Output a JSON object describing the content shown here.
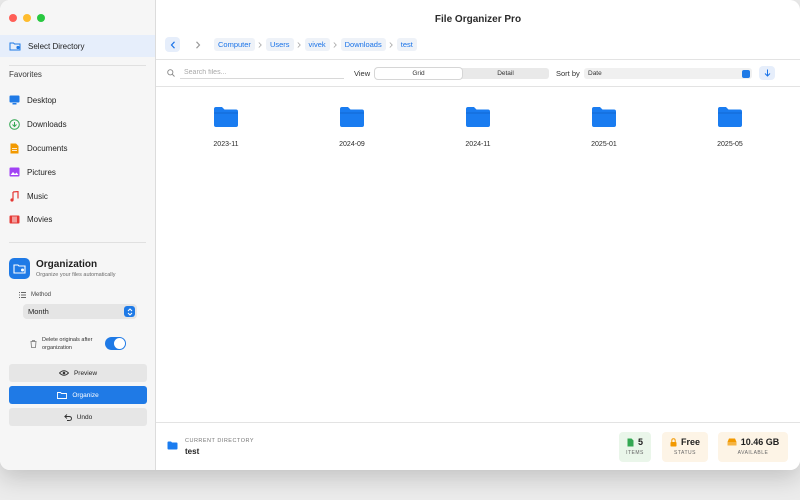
{
  "app": {
    "title": "File Organizer Pro"
  },
  "colors": {
    "accent": "#1f7ae6",
    "folder": "#1a7cf0",
    "green": "#34a853",
    "orange": "#f29900"
  },
  "sidebar": {
    "select_directory": "Select Directory",
    "favorites_title": "Favorites",
    "favorites": [
      {
        "label": "Desktop",
        "icon": "desktop-icon"
      },
      {
        "label": "Downloads",
        "icon": "download-icon"
      },
      {
        "label": "Documents",
        "icon": "document-icon"
      },
      {
        "label": "Pictures",
        "icon": "picture-icon"
      },
      {
        "label": "Music",
        "icon": "music-icon"
      },
      {
        "label": "Movies",
        "icon": "movie-icon"
      }
    ],
    "organization": {
      "title": "Organization",
      "subtitle": "Organize your files automatically",
      "method_label": "Method",
      "method_value": "Month",
      "delete_label": "Delete originals after organization",
      "delete_enabled": true,
      "preview_label": "Preview",
      "organize_label": "Organize",
      "undo_label": "Undo"
    }
  },
  "breadcrumbs": [
    "Computer",
    "Users",
    "vivek",
    "Downloads",
    "test"
  ],
  "toolbar": {
    "search_placeholder": "Search files...",
    "view_label": "View",
    "view_options": [
      "Grid",
      "Detail"
    ],
    "view_selected": "Grid",
    "sort_label": "Sort by",
    "sort_value": "Date"
  },
  "folders": [
    "2023-11",
    "2024-09",
    "2024-11",
    "2025-01",
    "2025-05"
  ],
  "status": {
    "current_dir_label": "CURRENT DIRECTORY",
    "current_dir_value": "test",
    "items_value": "5",
    "items_label": "ITEMS",
    "status_value": "Free",
    "status_label": "STATUS",
    "available_value": "10.46 GB",
    "available_label": "AVAILABLE"
  }
}
